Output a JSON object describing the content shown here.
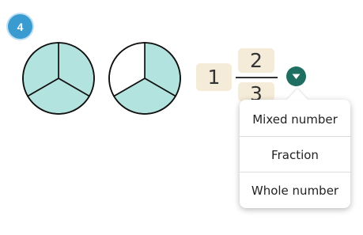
{
  "question": {
    "number": "4"
  },
  "models": {
    "fill_color": "#b3e3de",
    "empty_color": "#ffffff",
    "outline_color": "#111111",
    "circles": [
      {
        "parts": 3,
        "shaded": 3
      },
      {
        "parts": 3,
        "shaded": 2
      }
    ]
  },
  "answer": {
    "whole": "1",
    "numerator": "2",
    "denominator": "3",
    "box_color": "#f5ebd9"
  },
  "dropdown": {
    "toggle_icon": "triangle-down-icon",
    "toggle_color": "#1e6e62",
    "options": [
      "Mixed number",
      "Fraction",
      "Whole number"
    ]
  }
}
